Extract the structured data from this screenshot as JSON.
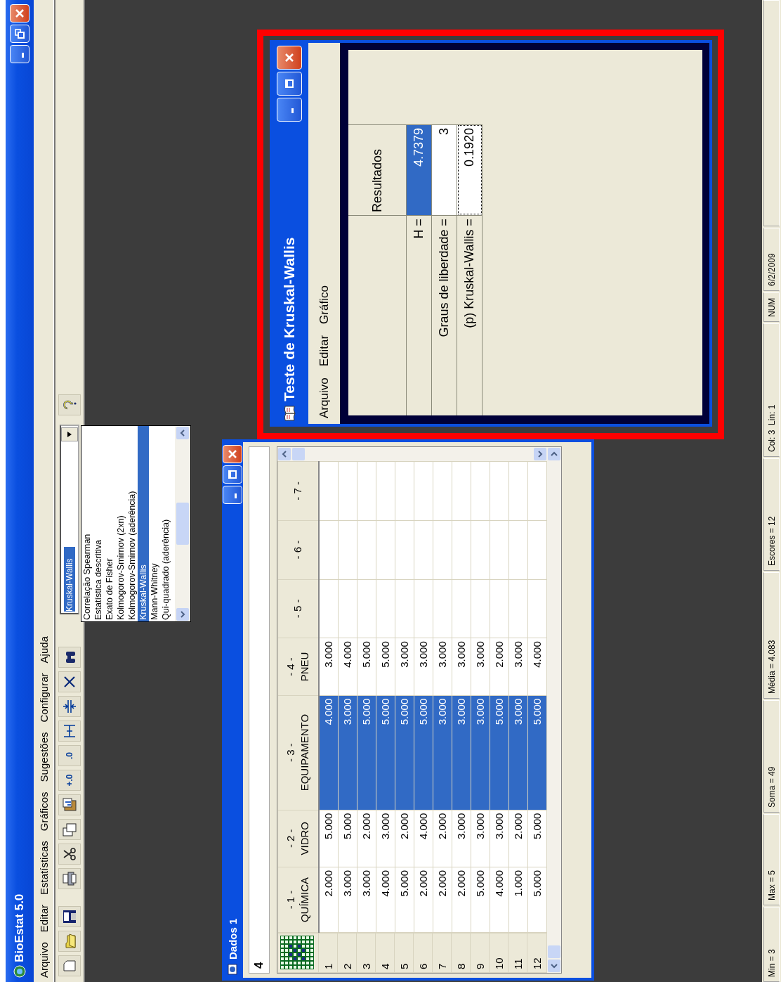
{
  "app": {
    "title": "BioEstat 5.0",
    "menu": [
      "Arquivo",
      "Editar",
      "Estatísticas",
      "Gráficos",
      "Sugestões",
      "Configurar",
      "Ajuda"
    ],
    "toolbar": {
      "decimal_buttons": [
        "+.0",
        ".0"
      ],
      "test_select": {
        "value": "Kruskal-Wallis",
        "highlighted": true
      }
    },
    "test_list": {
      "items": [
        {
          "label": "Correlação Spearman",
          "selected": false
        },
        {
          "label": "Estatística descritiva",
          "selected": false
        },
        {
          "label": "Exato de Fisher",
          "selected": false
        },
        {
          "label": "Kolmogorov-Smirnov (2xn)",
          "selected": false
        },
        {
          "label": "Kolmogorov-Smirnov (aderência)",
          "selected": false
        },
        {
          "label": "Kruskal-Wallis",
          "selected": true
        },
        {
          "label": "Mann-Whitney",
          "selected": false
        },
        {
          "label": "Qui-quadrado (aderência)",
          "selected": false
        }
      ]
    }
  },
  "data_window": {
    "title": "Dados 1",
    "entry": {
      "value": "4"
    },
    "variables": [
      {
        "number": "- 1 -",
        "name": "QUÍMICA",
        "selected": false
      },
      {
        "number": "- 2 -",
        "name": "VIDRO",
        "selected": false
      },
      {
        "number": "- 3 -",
        "name": "EQUIPAMENTO",
        "selected": true
      },
      {
        "number": "- 4 -",
        "name": "PNEU",
        "selected": false
      },
      {
        "number": "- 5 -",
        "selected": false
      },
      {
        "number": "- 6 -",
        "selected": false
      },
      {
        "number": "- 7 -",
        "selected": false
      }
    ],
    "cases": [
      {
        "label": "1",
        "cells": [
          "2.000",
          "5.000",
          "4.000",
          "3.000"
        ]
      },
      {
        "label": "2",
        "cells": [
          "3.000",
          "5.000",
          "3.000",
          "4.000"
        ]
      },
      {
        "label": "3",
        "cells": [
          "3.000",
          "2.000",
          "5.000",
          "5.000"
        ]
      },
      {
        "label": "4",
        "cells": [
          "4.000",
          "3.000",
          "5.000",
          "5.000"
        ]
      },
      {
        "label": "5",
        "cells": [
          "5.000",
          "2.000",
          "5.000",
          "3.000"
        ]
      },
      {
        "label": "6",
        "cells": [
          "2.000",
          "4.000",
          "5.000",
          "3.000"
        ]
      },
      {
        "label": "7",
        "cells": [
          "2.000",
          "2.000",
          "3.000",
          "3.000"
        ]
      },
      {
        "label": "8",
        "cells": [
          "2.000",
          "3.000",
          "3.000",
          "3.000"
        ]
      },
      {
        "label": "9",
        "cells": [
          "5.000",
          "3.000",
          "3.000",
          "3.000"
        ]
      },
      {
        "label": "10",
        "cells": [
          "4.000",
          "3.000",
          "5.000",
          "2.000"
        ]
      },
      {
        "label": "11",
        "cells": [
          "1.000",
          "2.000",
          "3.000",
          "3.000"
        ]
      },
      {
        "label": "12",
        "cells": [
          "5.000",
          "5.000",
          "5.000",
          "4.000"
        ]
      }
    ]
  },
  "result_window": {
    "title": "Teste de Kruskal-Wallis",
    "highlighted": true,
    "menu": [
      "Arquivo",
      "Editar",
      "Gráfico"
    ],
    "header": "Resultados",
    "rows": [
      {
        "label": "H =",
        "value": "4.7379",
        "selected": true,
        "focused": false
      },
      {
        "label": "Graus de liberdade =",
        "value": "3",
        "selected": false,
        "focused": false
      },
      {
        "label": "(p) Kruskal-Wallis =",
        "value": "0.1920",
        "selected": false,
        "focused": true
      }
    ]
  },
  "status_bar": [
    "Min = 3",
    "Max = 5",
    "Soma = 49",
    "Média = 4.083",
    "Escores = 12",
    "Col: 3  Lin: 1",
    "NUM",
    "6/2/2009"
  ]
}
